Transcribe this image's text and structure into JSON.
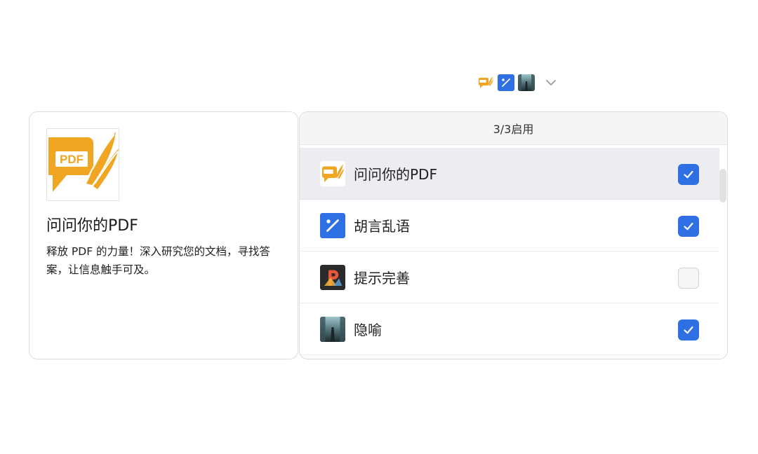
{
  "plugin_strip": {
    "icons": [
      "pdf-chat-icon",
      "gibberish-icon",
      "metaphor-icon"
    ],
    "expand_icon": "chevron-down-icon"
  },
  "detail": {
    "title": "问问你的PDF",
    "description": "释放 PDF 的力量！深入研究您的文档，寻找答案，让信息触手可及。",
    "logo_text": "PDF"
  },
  "list": {
    "header": "3/3启用",
    "items": [
      {
        "label": "问问你的PDF",
        "icon": "pdf-chat-icon",
        "checked": true,
        "selected": true
      },
      {
        "label": "胡言乱语",
        "icon": "gibberish-icon",
        "checked": true,
        "selected": false
      },
      {
        "label": "提示完善",
        "icon": "prompt-perfect-icon",
        "checked": false,
        "selected": false
      },
      {
        "label": "隐喻",
        "icon": "metaphor-icon",
        "checked": true,
        "selected": false
      }
    ]
  },
  "colors": {
    "accent": "#2f6fe4",
    "pdf_gold": "#f0a623",
    "selected_row": "#ececf1"
  }
}
